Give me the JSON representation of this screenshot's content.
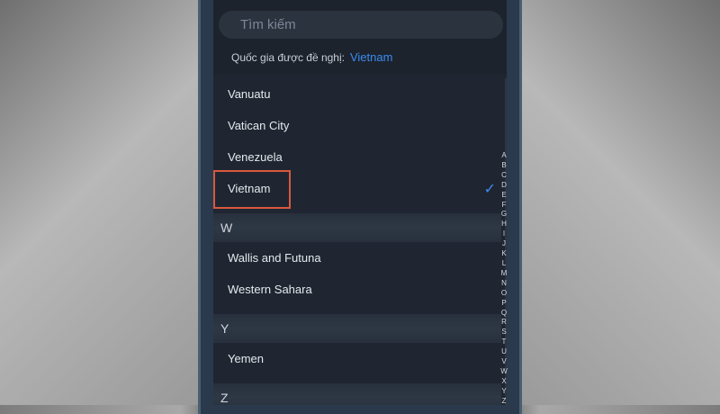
{
  "search": {
    "placeholder": "Tìm kiếm"
  },
  "suggested": {
    "label": "Quốc gia được đề nghị:",
    "value": "Vietnam"
  },
  "list": {
    "items_v": [
      "Vanuatu",
      "Vatican City",
      "Venezuela",
      "Vietnam"
    ],
    "selected": "Vietnam",
    "section_w": "W",
    "items_w": [
      "Wallis and Futuna",
      "Western Sahara"
    ],
    "section_y": "Y",
    "items_y": [
      "Yemen"
    ],
    "section_z": "Z"
  },
  "index_letters": [
    "A",
    "B",
    "C",
    "D",
    "E",
    "F",
    "G",
    "H",
    "I",
    "J",
    "K",
    "L",
    "M",
    "N",
    "O",
    "P",
    "Q",
    "R",
    "S",
    "T",
    "U",
    "V",
    "W",
    "X",
    "Y",
    "Z"
  ],
  "colors": {
    "accent": "#3c8bf0",
    "highlight": "#d8583f",
    "background": "#1f2631"
  },
  "icons": {
    "selected": "checkmark-icon"
  }
}
